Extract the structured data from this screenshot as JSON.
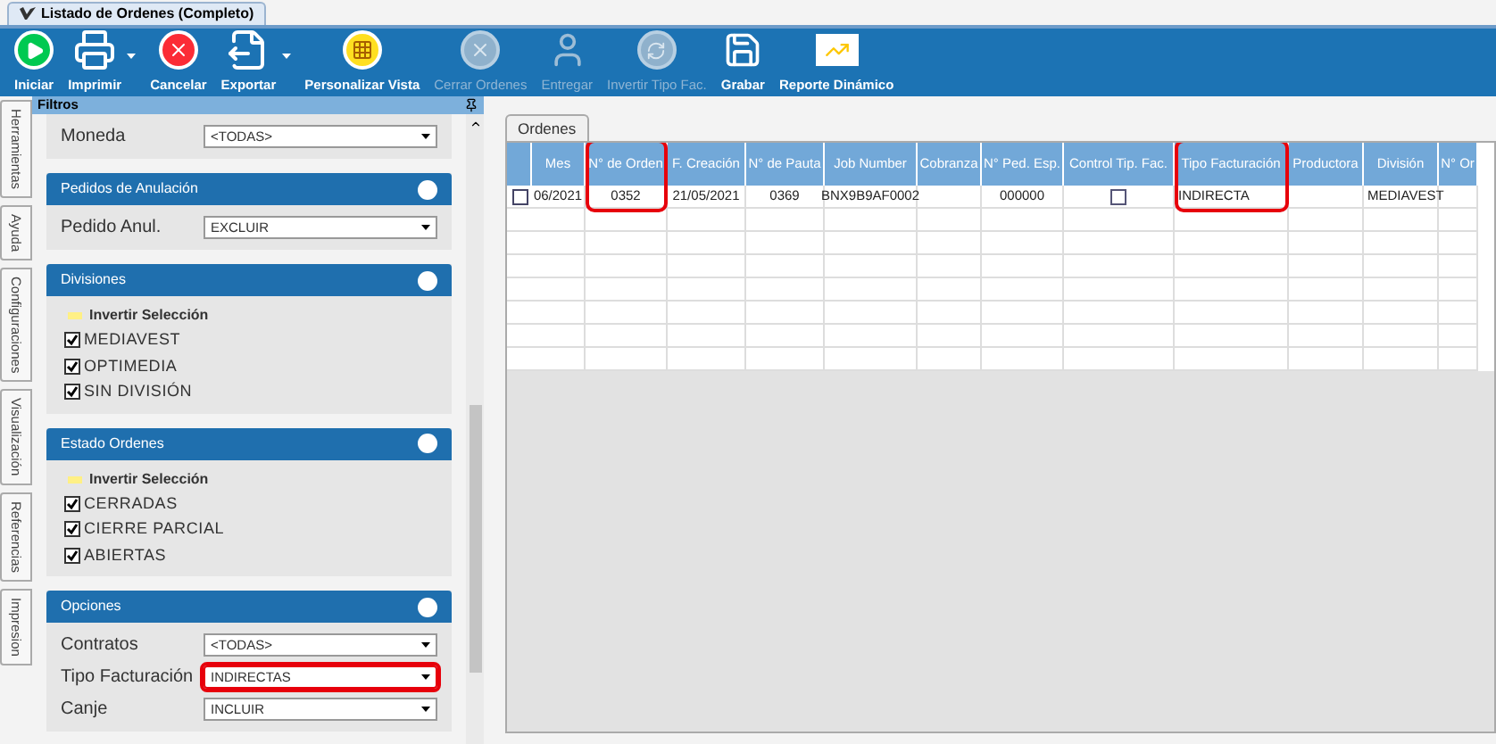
{
  "window": {
    "title": "Listado de Ordenes (Completo)"
  },
  "toolbar": [
    {
      "label": "Iniciar",
      "disabled": false,
      "has_menu": false
    },
    {
      "label": "Imprimir",
      "disabled": false,
      "has_menu": true
    },
    {
      "label": "Cancelar",
      "disabled": false,
      "has_menu": false
    },
    {
      "label": "Exportar",
      "disabled": false,
      "has_menu": true
    },
    {
      "label": "Personalizar Vista",
      "disabled": false,
      "has_menu": false
    },
    {
      "label": "Cerrar Ordenes",
      "disabled": true,
      "has_menu": false
    },
    {
      "label": "Entregar",
      "disabled": true,
      "has_menu": false
    },
    {
      "label": "Invertir Tipo Fac.",
      "disabled": true,
      "has_menu": false
    },
    {
      "label": "Grabar",
      "disabled": false,
      "has_menu": false
    },
    {
      "label": "Reporte Dinámico",
      "disabled": false,
      "has_menu": false
    }
  ],
  "side_tabs": [
    "Herramientas",
    "Ayuda",
    "Configuraciones",
    "Visualización",
    "Referencias",
    "Impresion"
  ],
  "filter_panel": {
    "title": "Filtros",
    "sections": [
      {
        "kind": "fields",
        "fields": [
          {
            "label": "Moneda",
            "value": "<TODAS>",
            "highlighted": false
          }
        ]
      },
      {
        "kind": "fields",
        "title": "Pedidos de Anulación",
        "fields": [
          {
            "label": "Pedido Anul.",
            "value": "EXCLUIR",
            "highlighted": false
          }
        ]
      },
      {
        "kind": "checklist",
        "title": "Divisiones",
        "action": "Invertir Selección",
        "items": [
          {
            "label": "MEDIAVEST",
            "checked": true
          },
          {
            "label": "OPTIMEDIA",
            "checked": true
          },
          {
            "label": "SIN DIVISIÓN",
            "checked": true
          }
        ]
      },
      {
        "kind": "checklist",
        "title": "Estado Ordenes",
        "action": "Invertir Selección",
        "items": [
          {
            "label": "CERRADAS",
            "checked": true
          },
          {
            "label": "CIERRE PARCIAL",
            "checked": true
          },
          {
            "label": "ABIERTAS",
            "checked": true
          }
        ]
      },
      {
        "kind": "fields",
        "title": "Opciones",
        "fields": [
          {
            "label": "Contratos",
            "value": "<TODAS>",
            "highlighted": false
          },
          {
            "label": "Tipo Facturación",
            "value": "INDIRECTAS",
            "highlighted": true
          },
          {
            "label": "Canje",
            "value": "INCLUIR",
            "highlighted": false
          }
        ]
      }
    ]
  },
  "grid": {
    "tab": "Ordenes",
    "columns": [
      {
        "label": "Mes",
        "kind": "text",
        "highlighted": false
      },
      {
        "label": "N° de Orden",
        "kind": "text",
        "highlighted": true
      },
      {
        "label": "F. Creación",
        "kind": "text",
        "highlighted": false
      },
      {
        "label": "N° de Pauta",
        "kind": "text",
        "highlighted": false
      },
      {
        "label": "Job Number",
        "kind": "text",
        "highlighted": false
      },
      {
        "label": "Cobranza",
        "kind": "text",
        "highlighted": false
      },
      {
        "label": "N° Ped. Esp.",
        "kind": "text",
        "highlighted": false
      },
      {
        "label": "Control Tip. Fac.",
        "kind": "check",
        "highlighted": false
      },
      {
        "label": "Tipo Facturación",
        "kind": "text",
        "highlighted": true
      },
      {
        "label": "Productora",
        "kind": "text",
        "highlighted": false
      },
      {
        "label": "División",
        "kind": "text",
        "highlighted": false
      },
      {
        "label": "N° Or",
        "kind": "text",
        "highlighted": false
      }
    ],
    "rows": [
      {
        "selected": false,
        "cells": [
          "06/2021",
          "0352",
          "21/05/2021",
          "0369",
          "BNX9B9AF0002",
          null,
          "000000",
          false,
          "INDIRECTA",
          null,
          "MEDIAVEST",
          null
        ]
      }
    ]
  }
}
